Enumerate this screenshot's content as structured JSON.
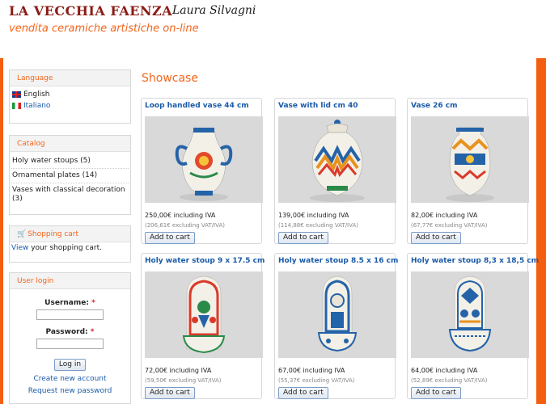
{
  "header": {
    "logo_text": "LA VECCHIA FAENZA",
    "signature": "Laura Silvagni",
    "tagline": "vendita ceramiche artistiche on-line"
  },
  "sidebar": {
    "language": {
      "title": "Language",
      "items": [
        "English",
        "Italiano"
      ]
    },
    "catalog": {
      "title": "Catalog",
      "items": [
        "Holy water stoups (5)",
        "Ornamental plates (14)",
        "Vases with classical decoration (3)"
      ]
    },
    "cart": {
      "title": "Shopping cart",
      "link": "View",
      "text": " your shopping cart."
    },
    "login": {
      "title": "User login",
      "username_label": "Username:",
      "password_label": "Password:",
      "required": "*",
      "button": "Log in",
      "create_account": "Create new account",
      "request_password": "Request new password"
    }
  },
  "main": {
    "title": "Showcase",
    "add_to_cart": "Add to cart",
    "products": [
      {
        "name": "Loop handled vase 44 cm",
        "price": "250,00€ including IVA",
        "note": "(206,61€ excluding VAT/IVA)"
      },
      {
        "name": "Vase with lid cm 40",
        "price": "139,00€ including IVA",
        "note": "(114,88€ excluding VAT/IVA)"
      },
      {
        "name": "Vase 26 cm",
        "price": "82,00€ including IVA",
        "note": "(67,77€ excluding VAT/IVA)"
      },
      {
        "name": "Holy water stoup 9 x 17.5 cm",
        "price": "72,00€ including IVA",
        "note": "(59,50€ excluding VAT/IVA)"
      },
      {
        "name": "Holy water stoup 8.5 x 16 cm",
        "price": "67,00€ including IVA",
        "note": "(55,37€ excluding VAT/IVA)"
      },
      {
        "name": "Holy water stoup 8,3 x 18,5 cm",
        "price": "64,00€ including IVA",
        "note": "(52,89€ excluding VAT/IVA)"
      }
    ]
  },
  "colors": {
    "accent": "#f2651c",
    "rail": "#f35e10",
    "link": "#1a5aa8",
    "logo": "#8b1c16"
  },
  "icons": [
    "uk-flag-icon",
    "italy-flag-icon",
    "cart-icon"
  ]
}
